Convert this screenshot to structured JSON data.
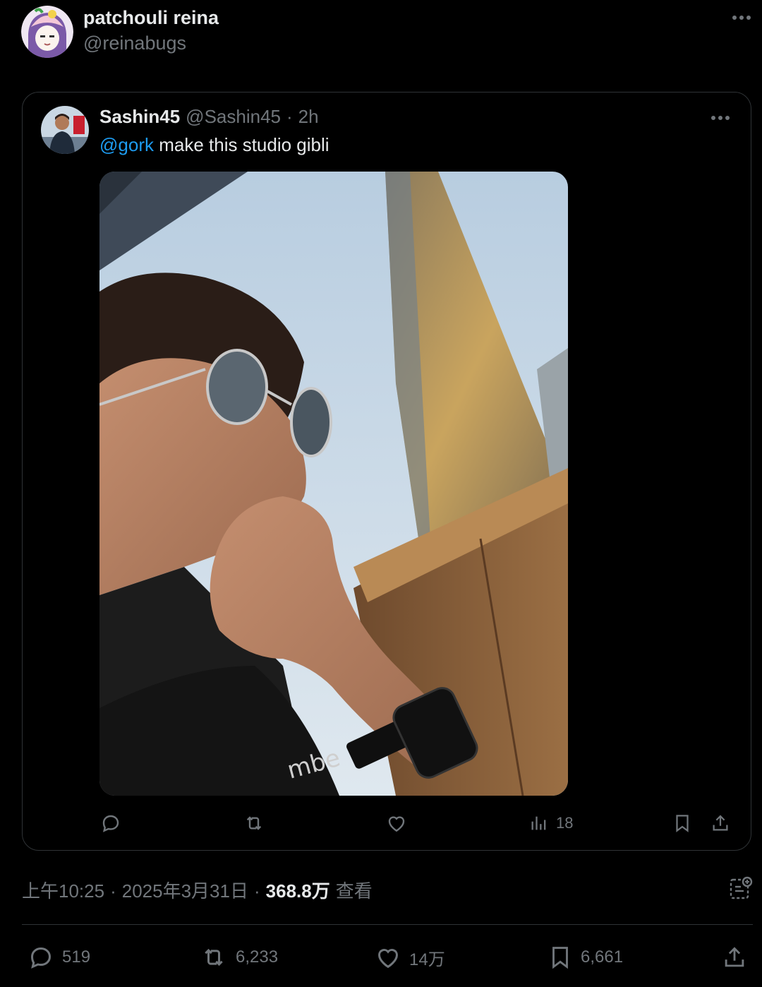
{
  "author": {
    "name": "patchouli reina",
    "handle": "@reinabugs"
  },
  "quoted_tweet": {
    "name": "Sashin45",
    "handle": "@Sashin45",
    "separator": "·",
    "time": "2h",
    "mention": "@gork",
    "text": " make this studio gibli",
    "views": "18"
  },
  "meta": {
    "time": "上午10:25",
    "separator": "·",
    "date": "2025年3月31日",
    "separator2": "·",
    "views": "368.8万",
    "views_label": "查看"
  },
  "stats": {
    "replies": "519",
    "reposts": "6,233",
    "likes": "14万",
    "bookmarks": "6,661"
  },
  "colors": {
    "background": "#000000",
    "text": "#e7e9ea",
    "secondary": "#71767b",
    "accent": "#1d9bf0",
    "border": "#2f3336"
  },
  "icons": [
    "more-icon",
    "reply-icon",
    "repost-icon",
    "like-icon",
    "views-icon",
    "bookmark-icon",
    "share-icon",
    "grok-icon"
  ]
}
